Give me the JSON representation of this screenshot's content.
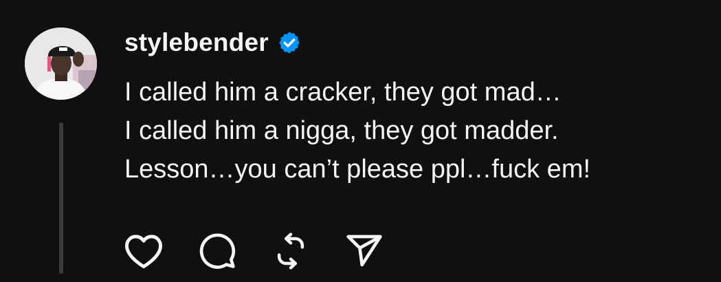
{
  "post": {
    "username": "stylebender",
    "verified": true,
    "text_lines": [
      "I called him a cracker, they got mad…",
      "I called him a nigga, they got madder.",
      "Lesson…you can’t please ppl…fuck em!"
    ]
  },
  "actions": [
    {
      "icon": "heart-icon",
      "label": "Like"
    },
    {
      "icon": "comment-icon",
      "label": "Reply"
    },
    {
      "icon": "repost-icon",
      "label": "Repost"
    },
    {
      "icon": "share-icon",
      "label": "Share"
    }
  ],
  "colors": {
    "background": "#101010",
    "text": "#f3f5f7",
    "verified_badge": "#0095f6",
    "thread_line": "#3a3a3a"
  }
}
